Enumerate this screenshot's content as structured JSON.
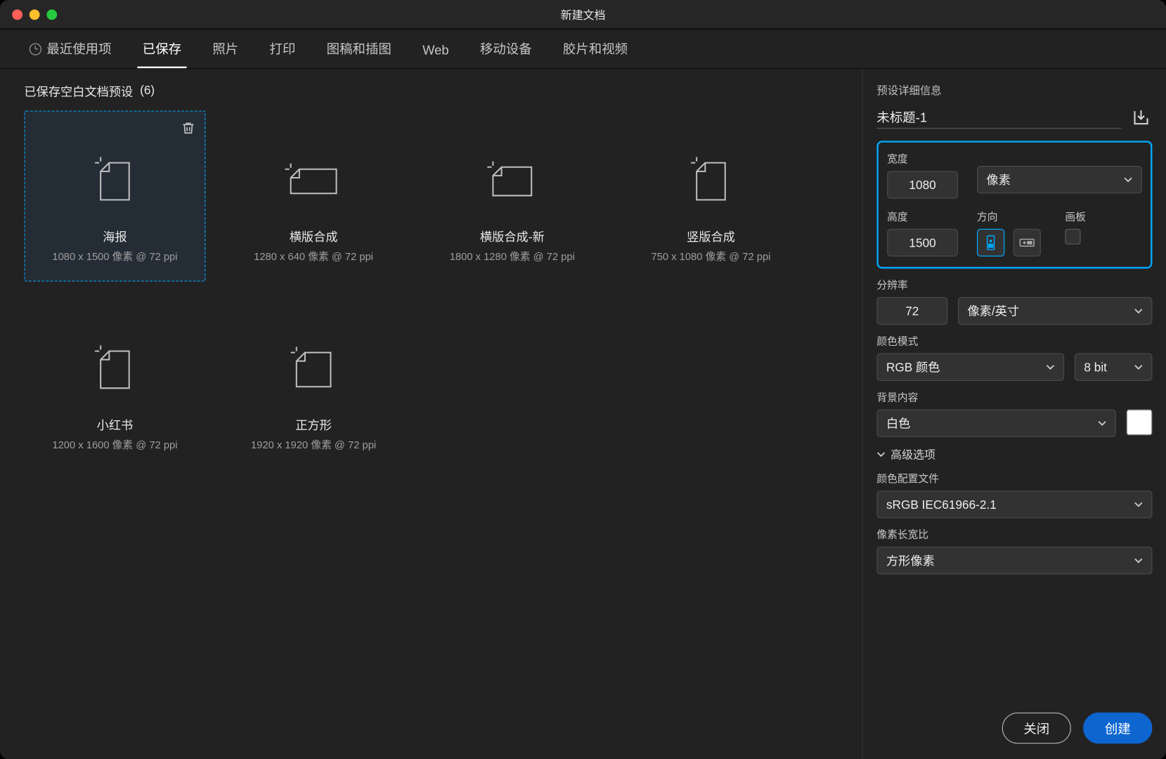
{
  "window": {
    "title": "新建文档"
  },
  "tabs": [
    {
      "label": "最近使用项"
    },
    {
      "label": "已保存"
    },
    {
      "label": "照片"
    },
    {
      "label": "打印"
    },
    {
      "label": "图稿和插图"
    },
    {
      "label": "Web"
    },
    {
      "label": "移动设备"
    },
    {
      "label": "胶片和视频"
    }
  ],
  "active_tab_index": 1,
  "gallery": {
    "heading": "已保存空白文档预设",
    "count": "(6)",
    "cards": [
      {
        "name": "海报",
        "dims": "1080 x 1500 像素 @ 72 ppi",
        "shape": "portrait",
        "selected": true
      },
      {
        "name": "横版合成",
        "dims": "1280 x 640 像素 @ 72 ppi",
        "shape": "wide",
        "selected": false
      },
      {
        "name": "横版合成-新",
        "dims": "1800 x 1280 像素 @ 72 ppi",
        "shape": "landscape",
        "selected": false
      },
      {
        "name": "竖版合成",
        "dims": "750 x 1080 像素 @ 72 ppi",
        "shape": "portrait",
        "selected": false
      },
      {
        "name": "小红书",
        "dims": "1200 x 1600 像素 @ 72 ppi",
        "shape": "portrait",
        "selected": false
      },
      {
        "name": "正方形",
        "dims": "1920 x 1920 像素 @ 72 ppi",
        "shape": "square",
        "selected": false
      }
    ]
  },
  "panel": {
    "heading": "预设详细信息",
    "doc_name": "未标题-1",
    "width_label": "宽度",
    "width_value": "1080",
    "unit_select": "像素",
    "height_label": "高度",
    "height_value": "1500",
    "orientation_label": "方向",
    "artboard_label": "画板",
    "artboard_checked": false,
    "orientation": "portrait",
    "resolution_label": "分辨率",
    "resolution_value": "72",
    "resolution_unit": "像素/英寸",
    "color_mode_label": "颜色模式",
    "color_mode": "RGB 颜色",
    "bit_depth": "8 bit",
    "background_label": "背景内容",
    "background": "白色",
    "advanced_toggle": "高级选项",
    "profile_label": "颜色配置文件",
    "profile": "sRGB IEC61966-2.1",
    "par_label": "像素长宽比",
    "par": "方形像素"
  },
  "buttons": {
    "close": "关闭",
    "create": "创建"
  }
}
